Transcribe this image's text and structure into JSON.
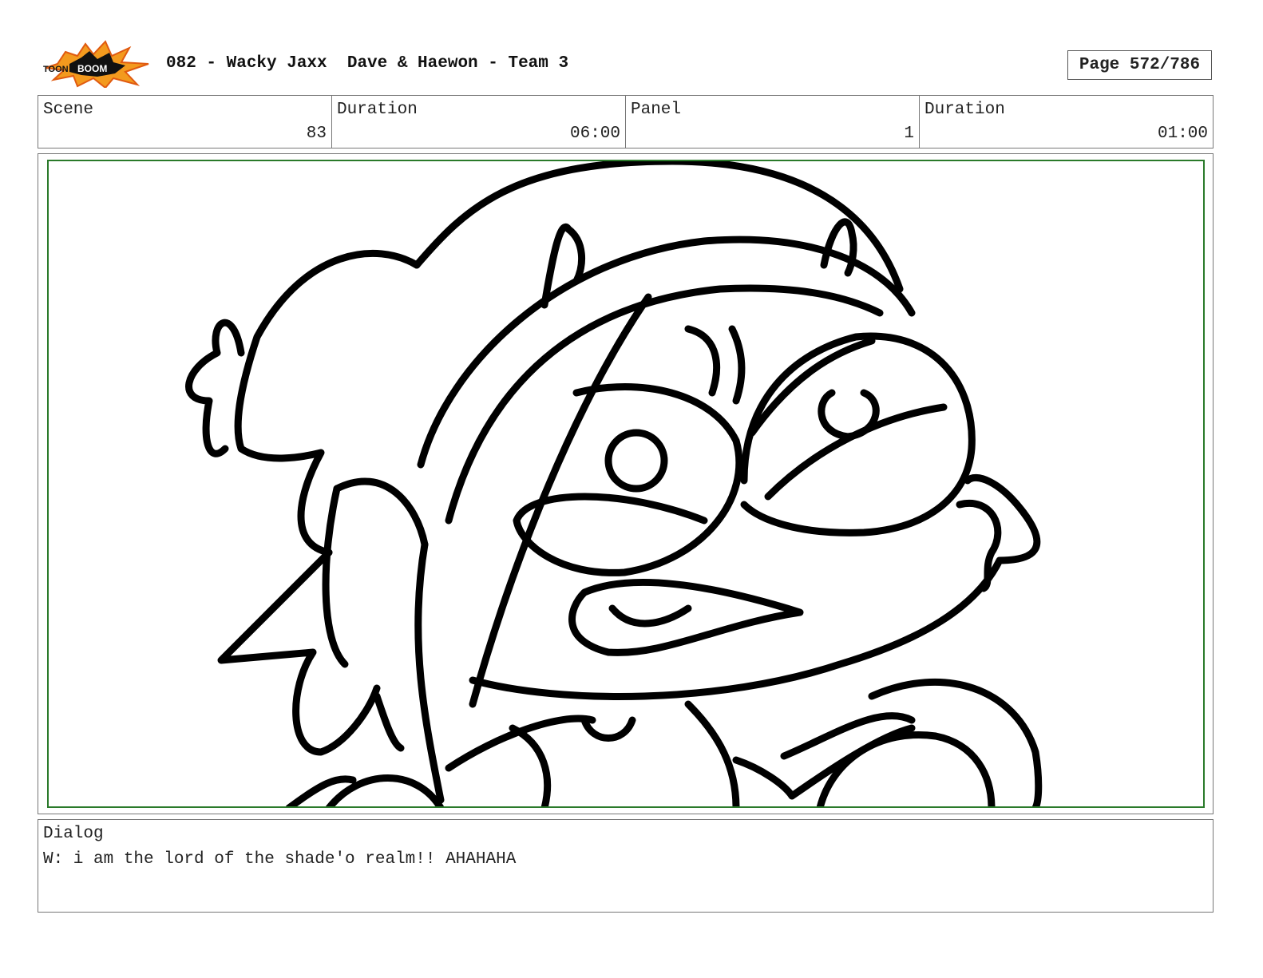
{
  "header": {
    "logo_text": "TOON BOOM",
    "title": "082 - Wacky Jaxx  Dave & Haewon - Team 3",
    "page": "Page 572/786"
  },
  "info": [
    {
      "label": "Scene",
      "value": "83"
    },
    {
      "label": "Duration",
      "value": "06:00"
    },
    {
      "label": "Panel",
      "value": "1"
    },
    {
      "label": "Duration",
      "value": "01:00"
    }
  ],
  "dialog": {
    "label": "Dialog",
    "text": "W: i am the lord of the shade'o realm!! AHAHAHA"
  },
  "colors": {
    "frame": "#2a7a2a",
    "logo_orange": "#f39a1e",
    "logo_black": "#111111"
  }
}
